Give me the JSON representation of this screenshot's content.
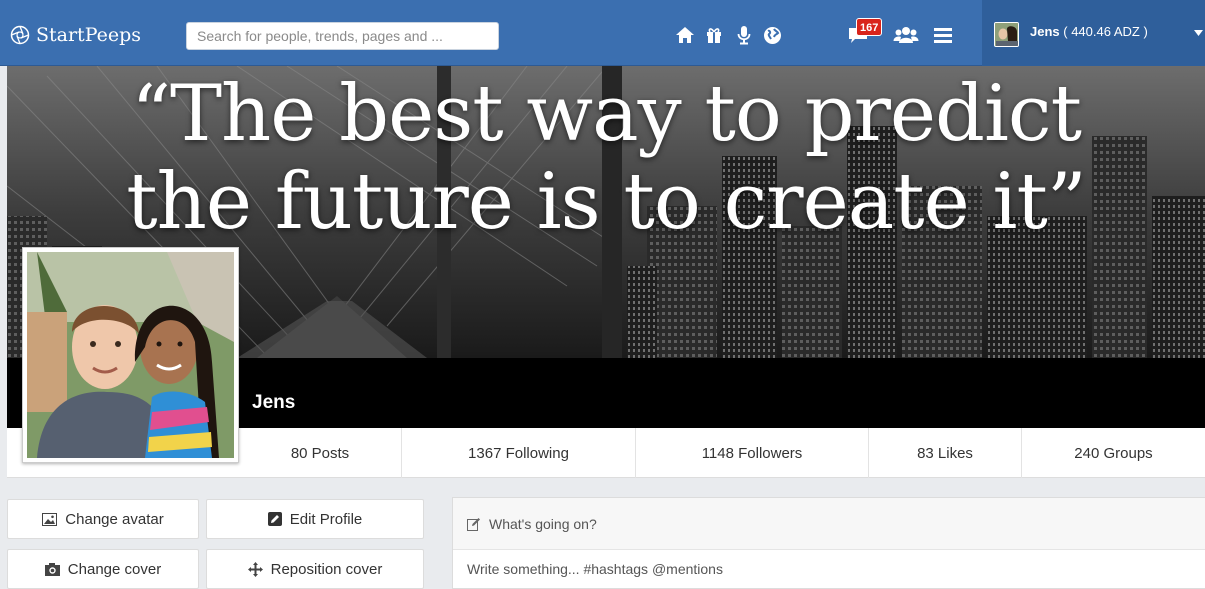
{
  "navbar": {
    "brand": "StartPeeps",
    "brand_icon": "aperture-logo-icon",
    "search_placeholder": "Search for people, trends, pages and ...",
    "icons": [
      "home-icon",
      "gift-icon",
      "microphone-icon",
      "globe-icon",
      "chat-icon",
      "users-icon",
      "menu-icon"
    ],
    "notification_count": "167",
    "user": {
      "name": "Jens",
      "balance": "( 440.46 ADZ )"
    },
    "colors": {
      "bar": "#3b6fb0",
      "user_area": "#2f5f9b",
      "badge": "#d9241b"
    }
  },
  "cover": {
    "quote_line1": "“The best way to predict",
    "quote_line2": "the future is to create it”"
  },
  "profile": {
    "name": "Jens"
  },
  "stats": [
    {
      "label": "80 Posts"
    },
    {
      "label": "1367 Following"
    },
    {
      "label": "1148 Followers"
    },
    {
      "label": "83 Likes"
    },
    {
      "label": "240 Groups"
    }
  ],
  "actions": {
    "change_avatar": "Change avatar",
    "edit_profile": "Edit Profile",
    "change_cover": "Change cover",
    "reposition_cover": "Reposition cover"
  },
  "composer": {
    "title": "What's going on?",
    "placeholder": "Write something... #hashtags @mentions"
  }
}
